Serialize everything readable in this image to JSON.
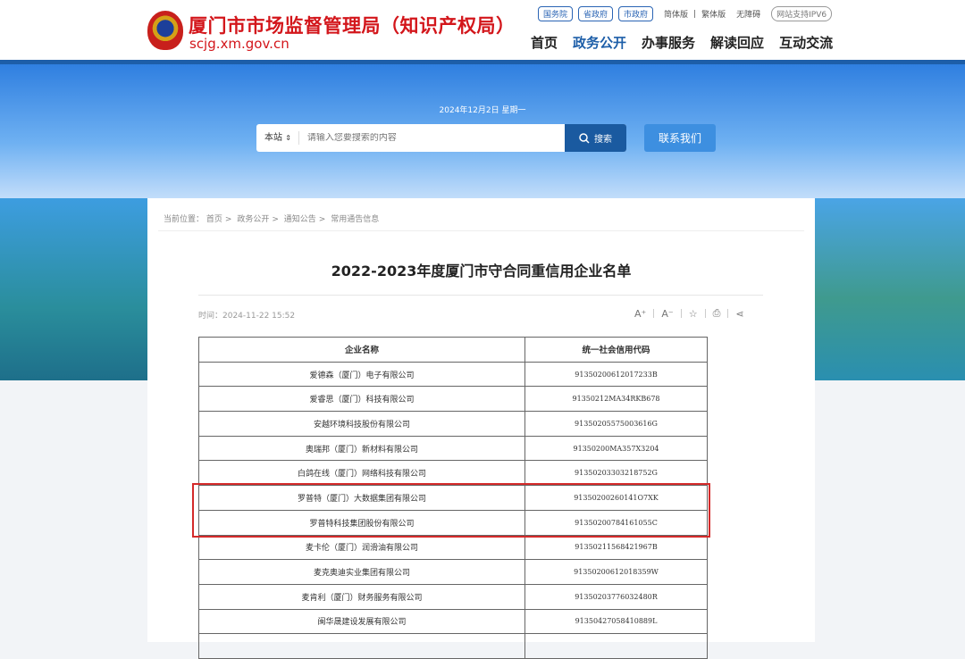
{
  "header": {
    "title": "厦门市市场监督管理局（知识产权局）",
    "domain": "scjg.xm.gov.cn",
    "top_links": [
      "国务院",
      "省政府",
      "市政府"
    ],
    "lang_simplified": "简体版",
    "lang_traditional": "繁体版",
    "accessibility": "无障碍",
    "ipv6": "网站支持IPV6",
    "nav": [
      "首页",
      "政务公开",
      "办事服务",
      "解读回应",
      "互动交流"
    ],
    "nav_active": 1
  },
  "banner": {
    "date": "2024年12月2日 星期一",
    "search_scope": "本站",
    "search_placeholder": "请输入您要搜索的内容",
    "search_button": "搜索",
    "contact_button": "联系我们"
  },
  "breadcrumb": {
    "label": "当前位置：",
    "items": [
      "首页",
      "政务公开",
      "通知公告",
      "常用通告信息"
    ]
  },
  "article": {
    "title": "2022-2023年度厦门市守合同重信用企业名单",
    "time": "时间：2024-11-22 15:52",
    "tools": {
      "font_up": "A⁺",
      "font_down": "A⁻",
      "star": "☆",
      "print": "⎙",
      "share": "⋖"
    }
  },
  "table": {
    "headers": [
      "企业名称",
      "统一社会信用代码"
    ],
    "rows": [
      [
        "爱德森（厦门）电子有限公司",
        "91350200612017233B"
      ],
      [
        "爱睿思（厦门）科技有限公司",
        "91350212MA34RKB678"
      ],
      [
        "安越环境科技股份有限公司",
        "91350205575003616G"
      ],
      [
        "奥瑞邦（厦门）新材料有限公司",
        "91350200MA357X3204"
      ],
      [
        "白鸽在线（厦门）网络科技有限公司",
        "91350203303218752G"
      ],
      [
        "罗普特（厦门）大数据集团有限公司",
        "91350200260141O7XK"
      ],
      [
        "罗普特科技集团股份有限公司",
        "91350200784161055C"
      ],
      [
        "麦卡伦（厦门）润滑油有限公司",
        "91350211568421967B"
      ],
      [
        "麦克奥迪实业集团有限公司",
        "91350200612018359W"
      ],
      [
        "麦肯利（厦门）财务服务有限公司",
        "91350203776032480R"
      ],
      [
        "闽华晟建设发展有限公司",
        "91350427058410889L"
      ],
      [
        "",
        ""
      ]
    ],
    "highlight_rows": [
      5,
      6
    ],
    "highlight_color": "#d42a2a"
  }
}
